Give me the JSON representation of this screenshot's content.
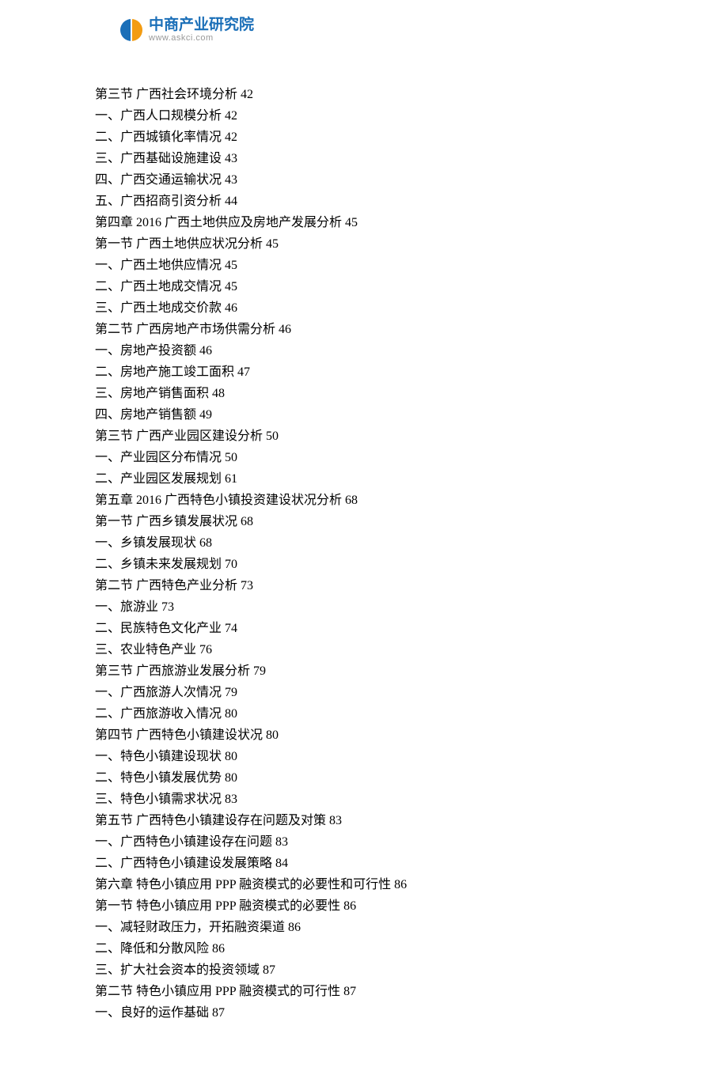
{
  "logo": {
    "title": "中商产业研究院",
    "url": "www.askci.com"
  },
  "toc": [
    {
      "text": "第三节 广西社会环境分析",
      "page": "42"
    },
    {
      "text": "一、广西人口规模分析",
      "page": "42"
    },
    {
      "text": "二、广西城镇化率情况",
      "page": "42"
    },
    {
      "text": "三、广西基础设施建设",
      "page": "43"
    },
    {
      "text": "四、广西交通运输状况",
      "page": "43"
    },
    {
      "text": "五、广西招商引资分析",
      "page": "44"
    },
    {
      "text": "第四章 2016 广西土地供应及房地产发展分析",
      "page": "45"
    },
    {
      "text": "第一节 广西土地供应状况分析",
      "page": "45"
    },
    {
      "text": "一、广西土地供应情况",
      "page": "45"
    },
    {
      "text": "二、广西土地成交情况",
      "page": "45"
    },
    {
      "text": "三、广西土地成交价款",
      "page": "46"
    },
    {
      "text": "第二节 广西房地产市场供需分析",
      "page": "46"
    },
    {
      "text": "一、房地产投资额",
      "page": "46"
    },
    {
      "text": "二、房地产施工竣工面积",
      "page": "47"
    },
    {
      "text": "三、房地产销售面积",
      "page": "48"
    },
    {
      "text": "四、房地产销售额",
      "page": "49"
    },
    {
      "text": "第三节 广西产业园区建设分析",
      "page": "50"
    },
    {
      "text": "一、产业园区分布情况",
      "page": "50"
    },
    {
      "text": "二、产业园区发展规划",
      "page": "61"
    },
    {
      "text": "第五章 2016 广西特色小镇投资建设状况分析",
      "page": "68"
    },
    {
      "text": "第一节 广西乡镇发展状况",
      "page": "68"
    },
    {
      "text": "一、乡镇发展现状",
      "page": "68"
    },
    {
      "text": "二、乡镇未来发展规划",
      "page": "70"
    },
    {
      "text": "第二节 广西特色产业分析",
      "page": "73"
    },
    {
      "text": "一、旅游业",
      "page": "73"
    },
    {
      "text": "二、民族特色文化产业",
      "page": "74"
    },
    {
      "text": "三、农业特色产业",
      "page": "76"
    },
    {
      "text": "第三节 广西旅游业发展分析",
      "page": "79"
    },
    {
      "text": "一、广西旅游人次情况",
      "page": "79"
    },
    {
      "text": "二、广西旅游收入情况",
      "page": "80"
    },
    {
      "text": "第四节 广西特色小镇建设状况",
      "page": "80"
    },
    {
      "text": "一、特色小镇建设现状",
      "page": "80"
    },
    {
      "text": "二、特色小镇发展优势",
      "page": "80"
    },
    {
      "text": "三、特色小镇需求状况",
      "page": "83"
    },
    {
      "text": "第五节 广西特色小镇建设存在问题及对策",
      "page": "83"
    },
    {
      "text": "一、广西特色小镇建设存在问题",
      "page": "83"
    },
    {
      "text": "二、广西特色小镇建设发展策略",
      "page": "84"
    },
    {
      "text": "第六章 特色小镇应用 PPP 融资模式的必要性和可行性",
      "page": "86"
    },
    {
      "text": "第一节 特色小镇应用 PPP 融资模式的必要性",
      "page": "86"
    },
    {
      "text": "一、减轻财政压力，开拓融资渠道",
      "page": "86"
    },
    {
      "text": "二、降低和分散风险",
      "page": "86"
    },
    {
      "text": "三、扩大社会资本的投资领域",
      "page": "87"
    },
    {
      "text": "第二节 特色小镇应用 PPP 融资模式的可行性",
      "page": "87"
    },
    {
      "text": "一、良好的运作基础",
      "page": "87"
    }
  ]
}
